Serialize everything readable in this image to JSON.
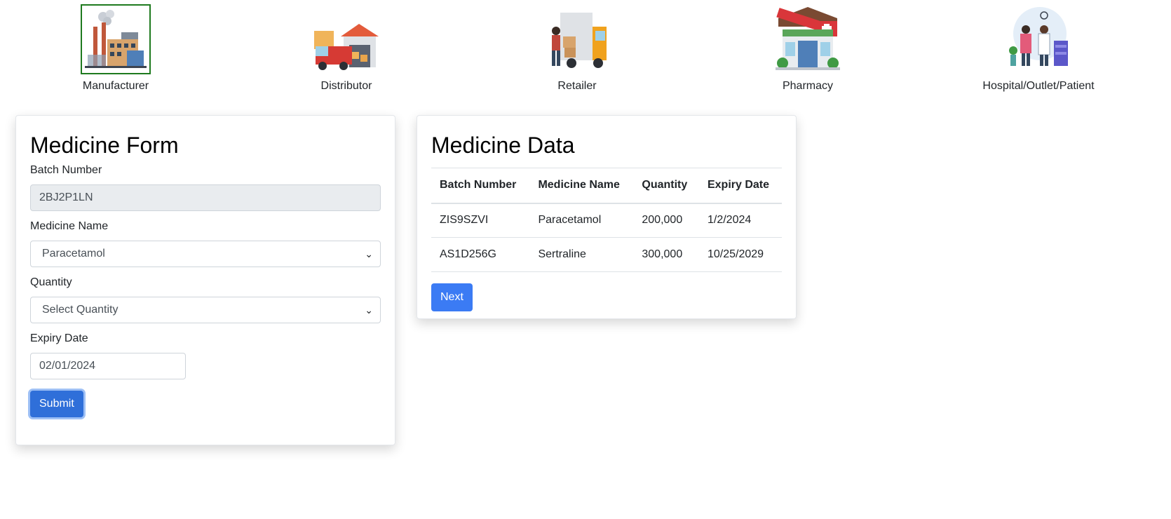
{
  "roles": [
    {
      "label": "Manufacturer",
      "icon": "factory-icon",
      "selected": true
    },
    {
      "label": "Distributor",
      "icon": "delivery-truck-warehouse-icon",
      "selected": false
    },
    {
      "label": "Retailer",
      "icon": "delivery-van-icon",
      "selected": false
    },
    {
      "label": "Pharmacy",
      "icon": "pharmacy-store-icon",
      "selected": false
    },
    {
      "label": "Hospital/Outlet/Patient",
      "icon": "doctor-patient-icon",
      "selected": false
    }
  ],
  "form": {
    "title": "Medicine Form",
    "batch_label": "Batch Number",
    "batch_value": "2BJ2P1LN",
    "name_label": "Medicine Name",
    "name_value": "Paracetamol",
    "quantity_label": "Quantity",
    "quantity_value": "Select Quantity",
    "expiry_label": "Expiry Date",
    "expiry_value": "02/01/2024",
    "submit_label": "Submit"
  },
  "data_table": {
    "title": "Medicine Data",
    "headers": [
      "Batch Number",
      "Medicine Name",
      "Quantity",
      "Expiry Date"
    ],
    "rows": [
      [
        "ZIS9SZVI",
        "Paracetamol",
        "200,000",
        "1/2/2024"
      ],
      [
        "AS1D256G",
        "Sertraline",
        "300,000",
        "10/25/2029"
      ]
    ],
    "next_label": "Next"
  },
  "colors": {
    "primary": "#3b7bf4",
    "submit": "#2f6fd9",
    "selected_border": "#1f7a1f"
  }
}
